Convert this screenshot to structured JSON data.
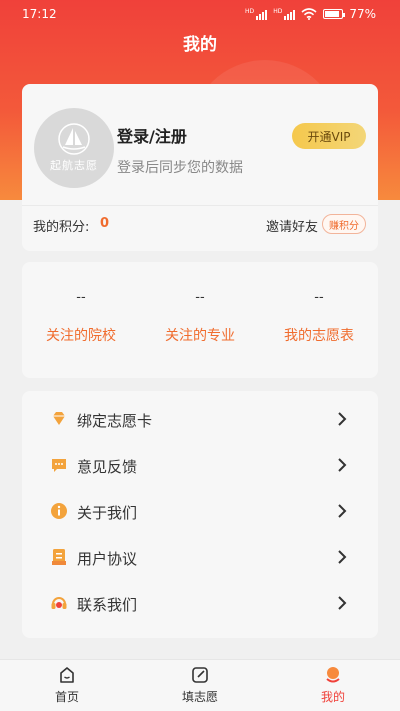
{
  "status_bar": {
    "time": "17:12",
    "battery": "77%",
    "battery_level": 0.77
  },
  "header": {
    "title": "我的"
  },
  "profile": {
    "avatar_logo_text": "起航志愿",
    "login_title": "登录/注册",
    "login_subtitle": "登录后同步您的数据",
    "vip_button": "开通VIP",
    "points_label": "我的积分:",
    "points_value": "0",
    "invite_label": "邀请好友",
    "earn_badge": "赚积分"
  },
  "stats": [
    {
      "value": "--",
      "label": "关注的院校"
    },
    {
      "value": "--",
      "label": "关注的专业"
    },
    {
      "value": "--",
      "label": "我的志愿表"
    }
  ],
  "menu": [
    {
      "label": "绑定志愿卡",
      "icon": "diamond-icon"
    },
    {
      "label": "意见反馈",
      "icon": "chat-icon"
    },
    {
      "label": "关于我们",
      "icon": "info-icon"
    },
    {
      "label": "用户协议",
      "icon": "document-icon"
    },
    {
      "label": "联系我们",
      "icon": "headset-icon"
    }
  ],
  "tabbar": [
    {
      "label": "首页",
      "icon": "home-icon"
    },
    {
      "label": "填志愿",
      "icon": "edit-icon"
    },
    {
      "label": "我的",
      "icon": "profile-icon",
      "active": true
    }
  ],
  "colors": {
    "accent": "#f0413a",
    "orange": "#f06c2e",
    "icon_orange": "#f3a33c",
    "vip_gold": "#f5c84d"
  }
}
